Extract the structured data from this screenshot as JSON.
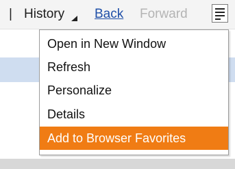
{
  "toolbar": {
    "separator": "|",
    "history_label": "History",
    "back_label": "Back",
    "forward_label": "Forward"
  },
  "menu": {
    "items": [
      {
        "label": "Open in New Window"
      },
      {
        "label": "Refresh"
      },
      {
        "label": "Personalize"
      },
      {
        "label": "Details"
      },
      {
        "label": "Add to Browser Favorites",
        "highlighted": true
      }
    ]
  },
  "colors": {
    "link": "#1f4fa8",
    "disabled": "#b4b4b4",
    "highlight": "#f07c14",
    "row_highlight_bg": "#cfddf0"
  }
}
